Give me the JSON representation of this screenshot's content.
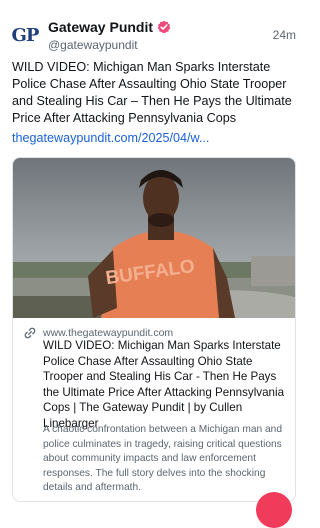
{
  "account": {
    "avatar_text": "GP",
    "display_name": "Gateway Pundit",
    "handle": "@gatewaypundit",
    "timestamp": "24m",
    "verified_color": "#ec4a7a"
  },
  "post": {
    "text": "WILD VIDEO: Michigan Man Sparks Interstate Police Chase After Assaulting Ohio State Trooper and Stealing His Car – Then He Pays the Ultimate Price After Attacking Pennsylvania Cops",
    "link_text": "thegatewaypundit.com/2025/04/w..."
  },
  "card": {
    "domain": "www.thegatewaypundit.com",
    "title": "WILD VIDEO: Michigan Man Sparks Interstate Police Chase After Assaulting Ohio State Trooper and Stealing His Car - Then He Pays the Ultimate Price After Attacking Pennsylvania Cops | The Gateway Pundit | by Cullen Linebarger",
    "description": "A chaotic confrontation between a Michigan man and police culminates in tragedy, raising critical questions about community impacts and law enforcement responses. The full story delves into the shocking details and aftermath.",
    "shirt_text": "BUFFALO"
  },
  "colors": {
    "link": "#1b62d8",
    "fab": "#f03b5b"
  }
}
